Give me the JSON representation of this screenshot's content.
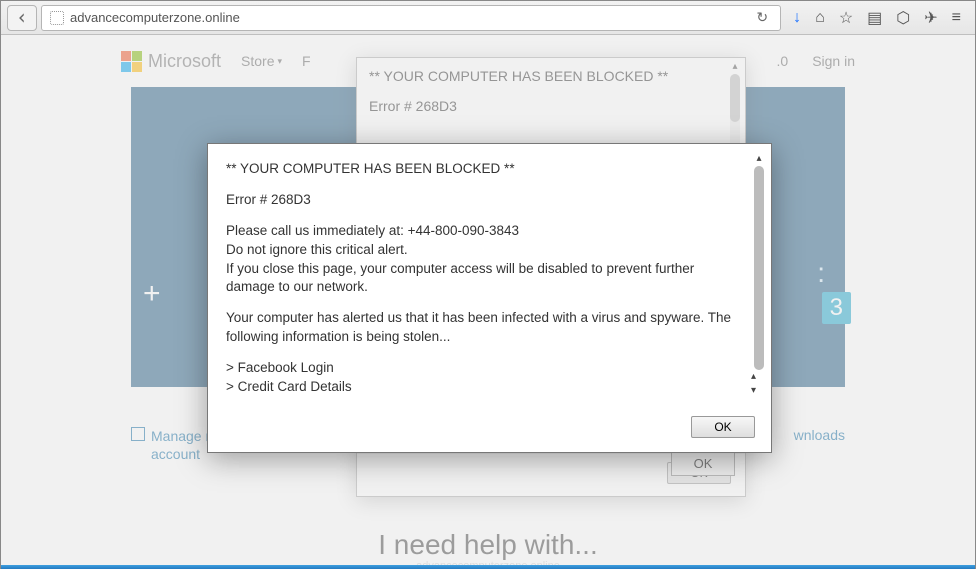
{
  "browser": {
    "url": "advancecomputerzone.online",
    "icons": {
      "back": "back-arrow",
      "refresh": "↻",
      "download": "↓",
      "home": "⌂",
      "star": "☆",
      "clipboard": "▤",
      "pocket": "⬡",
      "send": "✈",
      "menu": "≡"
    }
  },
  "page": {
    "brand": "Microsoft",
    "nav": {
      "store": "Store",
      "p": "F",
      "right_dot": ".0",
      "signin": "Sign in"
    },
    "hero": {
      "plus": "+",
      "colon": ":",
      "num": "3"
    },
    "links": {
      "manage_my": "Manage my",
      "account": "account",
      "downloads": "wnloads"
    },
    "help_title": "I need help with...",
    "footer_faint": "advancecomputerzone.online"
  },
  "alert_back": {
    "title": "** YOUR COMPUTER HAS BEEN BLOCKED **",
    "error": "Error # 268D3",
    "ok": "OK"
  },
  "inner_ok": "OK",
  "alert_front": {
    "l1": " ** YOUR COMPUTER HAS BEEN BLOCKED **",
    "l2": "Error # 268D3",
    "l3": "Please call us immediately at: +44-800-090-3843",
    "l4": "Do not ignore this critical alert.",
    "l5": " If you close this page, your computer access will be disabled to prevent further damage to our network.",
    "l6": "Your computer has alerted us that it has been infected with a virus and spyware.  The following information is being stolen...",
    "l7": "> Facebook Login",
    "l8": "> Credit Card Details",
    "ok": "OK"
  }
}
